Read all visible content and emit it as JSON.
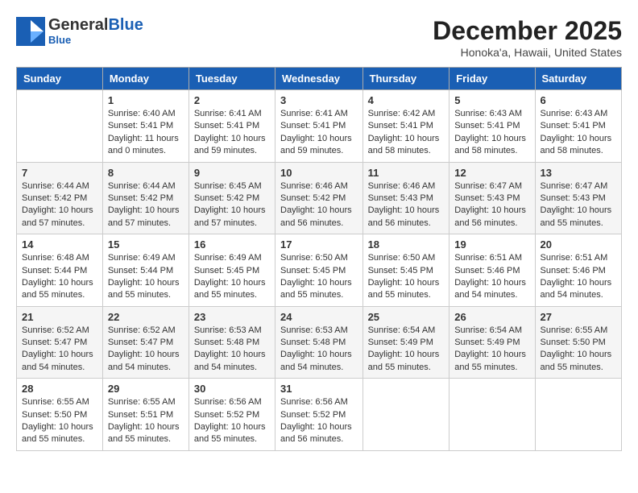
{
  "header": {
    "logo_general": "General",
    "logo_blue": "Blue",
    "month_title": "December 2025",
    "location": "Honoka'a, Hawaii, United States"
  },
  "weekdays": [
    "Sunday",
    "Monday",
    "Tuesday",
    "Wednesday",
    "Thursday",
    "Friday",
    "Saturday"
  ],
  "weeks": [
    [
      {
        "day": "",
        "info": ""
      },
      {
        "day": "1",
        "info": "Sunrise: 6:40 AM\nSunset: 5:41 PM\nDaylight: 11 hours\nand 0 minutes."
      },
      {
        "day": "2",
        "info": "Sunrise: 6:41 AM\nSunset: 5:41 PM\nDaylight: 10 hours\nand 59 minutes."
      },
      {
        "day": "3",
        "info": "Sunrise: 6:41 AM\nSunset: 5:41 PM\nDaylight: 10 hours\nand 59 minutes."
      },
      {
        "day": "4",
        "info": "Sunrise: 6:42 AM\nSunset: 5:41 PM\nDaylight: 10 hours\nand 58 minutes."
      },
      {
        "day": "5",
        "info": "Sunrise: 6:43 AM\nSunset: 5:41 PM\nDaylight: 10 hours\nand 58 minutes."
      },
      {
        "day": "6",
        "info": "Sunrise: 6:43 AM\nSunset: 5:41 PM\nDaylight: 10 hours\nand 58 minutes."
      }
    ],
    [
      {
        "day": "7",
        "info": "Sunrise: 6:44 AM\nSunset: 5:42 PM\nDaylight: 10 hours\nand 57 minutes."
      },
      {
        "day": "8",
        "info": "Sunrise: 6:44 AM\nSunset: 5:42 PM\nDaylight: 10 hours\nand 57 minutes."
      },
      {
        "day": "9",
        "info": "Sunrise: 6:45 AM\nSunset: 5:42 PM\nDaylight: 10 hours\nand 57 minutes."
      },
      {
        "day": "10",
        "info": "Sunrise: 6:46 AM\nSunset: 5:42 PM\nDaylight: 10 hours\nand 56 minutes."
      },
      {
        "day": "11",
        "info": "Sunrise: 6:46 AM\nSunset: 5:43 PM\nDaylight: 10 hours\nand 56 minutes."
      },
      {
        "day": "12",
        "info": "Sunrise: 6:47 AM\nSunset: 5:43 PM\nDaylight: 10 hours\nand 56 minutes."
      },
      {
        "day": "13",
        "info": "Sunrise: 6:47 AM\nSunset: 5:43 PM\nDaylight: 10 hours\nand 55 minutes."
      }
    ],
    [
      {
        "day": "14",
        "info": "Sunrise: 6:48 AM\nSunset: 5:44 PM\nDaylight: 10 hours\nand 55 minutes."
      },
      {
        "day": "15",
        "info": "Sunrise: 6:49 AM\nSunset: 5:44 PM\nDaylight: 10 hours\nand 55 minutes."
      },
      {
        "day": "16",
        "info": "Sunrise: 6:49 AM\nSunset: 5:45 PM\nDaylight: 10 hours\nand 55 minutes."
      },
      {
        "day": "17",
        "info": "Sunrise: 6:50 AM\nSunset: 5:45 PM\nDaylight: 10 hours\nand 55 minutes."
      },
      {
        "day": "18",
        "info": "Sunrise: 6:50 AM\nSunset: 5:45 PM\nDaylight: 10 hours\nand 55 minutes."
      },
      {
        "day": "19",
        "info": "Sunrise: 6:51 AM\nSunset: 5:46 PM\nDaylight: 10 hours\nand 54 minutes."
      },
      {
        "day": "20",
        "info": "Sunrise: 6:51 AM\nSunset: 5:46 PM\nDaylight: 10 hours\nand 54 minutes."
      }
    ],
    [
      {
        "day": "21",
        "info": "Sunrise: 6:52 AM\nSunset: 5:47 PM\nDaylight: 10 hours\nand 54 minutes."
      },
      {
        "day": "22",
        "info": "Sunrise: 6:52 AM\nSunset: 5:47 PM\nDaylight: 10 hours\nand 54 minutes."
      },
      {
        "day": "23",
        "info": "Sunrise: 6:53 AM\nSunset: 5:48 PM\nDaylight: 10 hours\nand 54 minutes."
      },
      {
        "day": "24",
        "info": "Sunrise: 6:53 AM\nSunset: 5:48 PM\nDaylight: 10 hours\nand 54 minutes."
      },
      {
        "day": "25",
        "info": "Sunrise: 6:54 AM\nSunset: 5:49 PM\nDaylight: 10 hours\nand 55 minutes."
      },
      {
        "day": "26",
        "info": "Sunrise: 6:54 AM\nSunset: 5:49 PM\nDaylight: 10 hours\nand 55 minutes."
      },
      {
        "day": "27",
        "info": "Sunrise: 6:55 AM\nSunset: 5:50 PM\nDaylight: 10 hours\nand 55 minutes."
      }
    ],
    [
      {
        "day": "28",
        "info": "Sunrise: 6:55 AM\nSunset: 5:50 PM\nDaylight: 10 hours\nand 55 minutes."
      },
      {
        "day": "29",
        "info": "Sunrise: 6:55 AM\nSunset: 5:51 PM\nDaylight: 10 hours\nand 55 minutes."
      },
      {
        "day": "30",
        "info": "Sunrise: 6:56 AM\nSunset: 5:52 PM\nDaylight: 10 hours\nand 55 minutes."
      },
      {
        "day": "31",
        "info": "Sunrise: 6:56 AM\nSunset: 5:52 PM\nDaylight: 10 hours\nand 56 minutes."
      },
      {
        "day": "",
        "info": ""
      },
      {
        "day": "",
        "info": ""
      },
      {
        "day": "",
        "info": ""
      }
    ]
  ]
}
